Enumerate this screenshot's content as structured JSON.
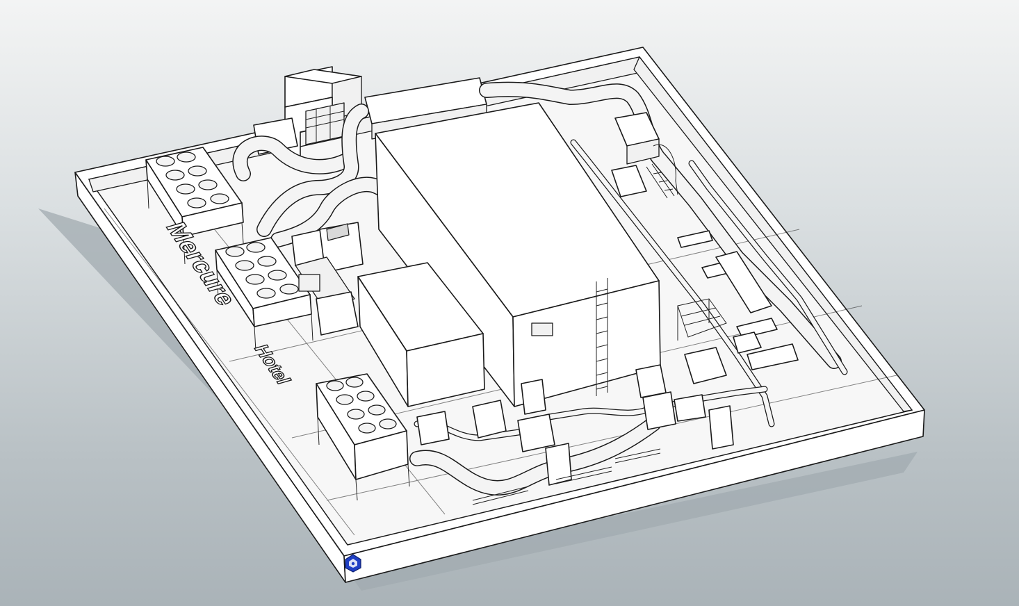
{
  "scene": {
    "sign_text_main": "Mercure",
    "sign_text_sub": "Hotel"
  },
  "view_cube": {
    "icon": "view-cube-icon",
    "color": "#1f3fc4"
  },
  "colors": {
    "background_top": "#f3f4f4",
    "background_bottom": "#aab3b8",
    "shadow": "#a5aeb3",
    "line": "#1a1a1a"
  }
}
